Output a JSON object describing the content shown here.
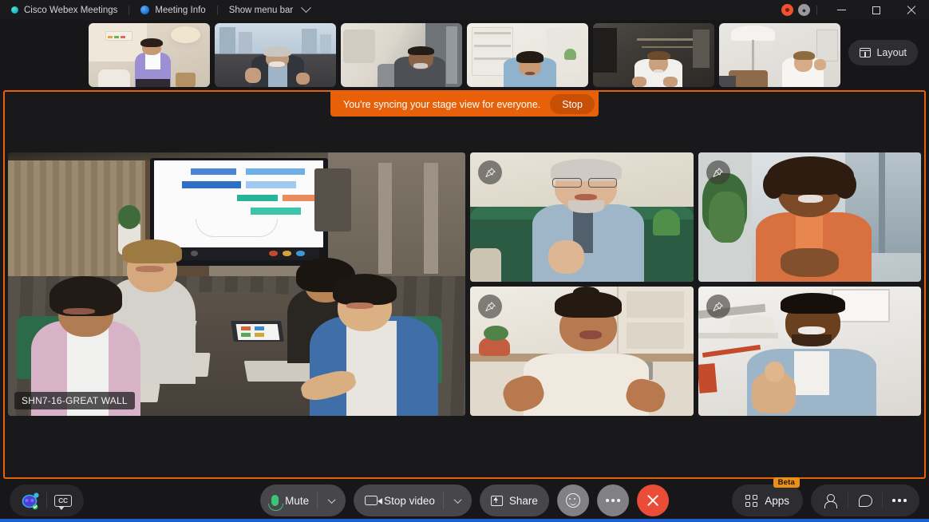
{
  "titlebar": {
    "app_name": "Cisco Webex Meetings",
    "meeting_info": "Meeting Info",
    "show_menu_bar": "Show menu bar",
    "app_icon": "webex-logo-icon",
    "meeting_info_icon": "info-circle-icon",
    "chevron_icon": "chevron-down-icon",
    "recording_icon": "recording-icon",
    "network_icon": "network-quality-icon",
    "minimize_icon": "minimize-icon",
    "maximize_icon": "maximize-icon",
    "close_icon": "close-icon"
  },
  "filmstrip": {
    "layout_button_label": "Layout",
    "layout_icon": "layout-grid-icon",
    "thumbnails": [
      {
        "name": "participant-thumbnail-1",
        "scene": "woman-purple-jacket-living-room"
      },
      {
        "name": "participant-thumbnail-2",
        "scene": "older-man-waving-city-window"
      },
      {
        "name": "participant-thumbnail-3",
        "scene": "man-gray-sweater-office"
      },
      {
        "name": "participant-thumbnail-4",
        "scene": "woman-blue-shirt-bookshelf"
      },
      {
        "name": "participant-thumbnail-5",
        "scene": "man-white-shirt-dark-office"
      },
      {
        "name": "participant-thumbnail-6",
        "scene": "woman-waving-white-lamp"
      }
    ]
  },
  "stage": {
    "banner_text": "You're syncing your stage view for everyone.",
    "banner_stop_label": "Stop",
    "banner_color": "#e8610a",
    "border_color": "#e8610a",
    "main_video": {
      "name": "main-stage-video",
      "label": "SHN7-16-GREAT WALL",
      "scene": "conference-room-five-people-whiteboard"
    },
    "pin_icon": "pin-icon",
    "tiles": [
      {
        "name": "participant-tile-1",
        "scene": "older-man-glasses-green-couch"
      },
      {
        "name": "participant-tile-2",
        "scene": "woman-orange-top-plant"
      },
      {
        "name": "participant-tile-3",
        "scene": "woman-white-blouse-kitchen"
      },
      {
        "name": "participant-tile-4",
        "scene": "man-denim-shirt-thumbs-up"
      }
    ]
  },
  "bottombar": {
    "assistant_icon": "webex-ai-assistant-icon",
    "captions_icon": "closed-captions-icon",
    "mute_label": "Mute",
    "mute_icon": "microphone-icon",
    "stop_video_label": "Stop video",
    "stop_video_icon": "camera-icon",
    "share_label": "Share",
    "share_icon": "share-screen-icon",
    "reactions_icon": "reactions-smiley-icon",
    "more_options_icon": "more-horizontal-icon",
    "end_call_icon": "end-call-x-icon",
    "apps_label": "Apps",
    "apps_icon": "apps-grid-icon",
    "apps_badge": "Beta",
    "participants_icon": "participants-icon",
    "chat_icon": "chat-bubble-icon",
    "more_right_icon": "more-horizontal-icon",
    "accent_blue": "#1f5fd0",
    "mic_green": "#3cc37a",
    "end_red": "#eb4c38"
  }
}
